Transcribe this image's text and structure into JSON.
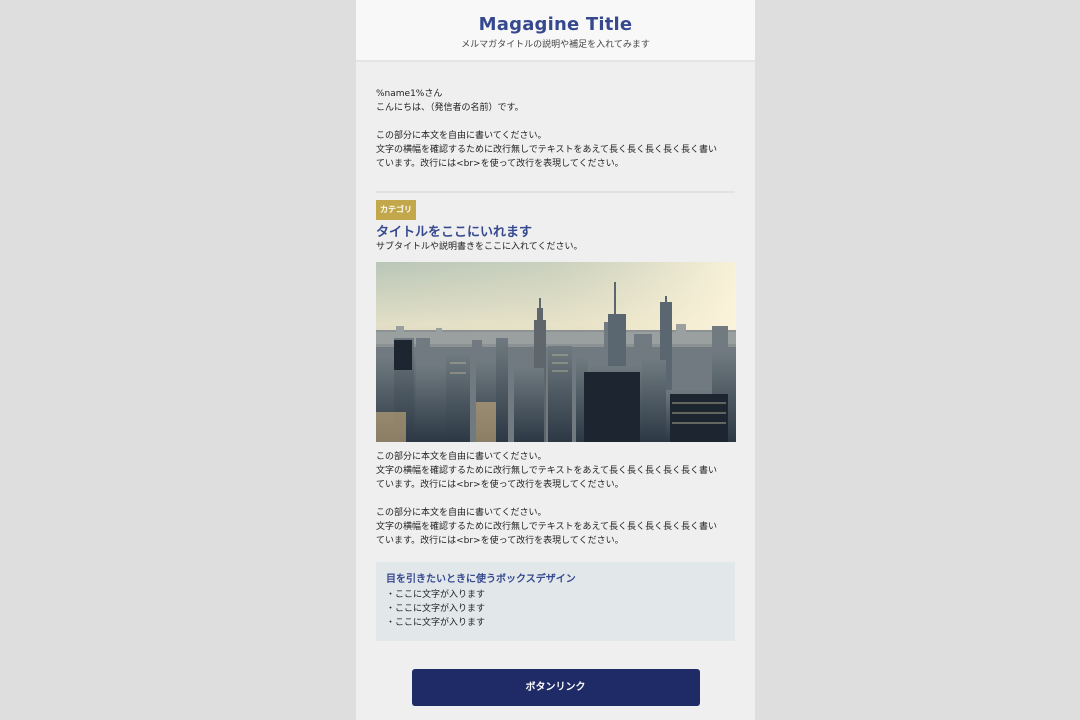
{
  "header": {
    "title": "Magagine Title",
    "subtitle": "メルマガタイトルの説明や補足を入れてみます"
  },
  "greeting": {
    "name_line": "%name1%さん",
    "hello_line": "こんにちは、（発信者の名前）です。"
  },
  "intro": {
    "lines": [
      "この部分に本文を自由に書いてください。",
      "文字の横幅を確認するために改行無しでテキストをあえて長く長く長く長く長く書い",
      "ています。改行には<br>を使って改行を表現してください。"
    ]
  },
  "article": {
    "category": "カテゴリ",
    "title": "タイトルをここにいれます",
    "subtitle": "サブタイトルや説明書きをここに入れてください。",
    "image_icon": "city-skyline-photo",
    "body1": [
      "この部分に本文を自由に書いてください。",
      "文字の横幅を確認するために改行無しでテキストをあえて長く長く長く長く長く書い",
      "ています。改行には<br>を使って改行を表現してください。"
    ],
    "body2": [
      "この部分に本文を自由に書いてください。",
      "文字の横幅を確認するために改行無しでテキストをあえて長く長く長く長く長く書い",
      "ています。改行には<br>を使って改行を表現してください。"
    ]
  },
  "highlight_box": {
    "title": "目を引きたいときに使うボックスデザイン",
    "items": [
      "・ここに文字が入ります",
      "・ここに文字が入ります",
      "・ここに文字が入ります"
    ]
  },
  "button": {
    "label": "ボタンリンク"
  },
  "colors": {
    "accent": "#36498f",
    "button": "#1f2b67",
    "category": "#c2a84a",
    "box_bg": "#e2e7ea"
  }
}
